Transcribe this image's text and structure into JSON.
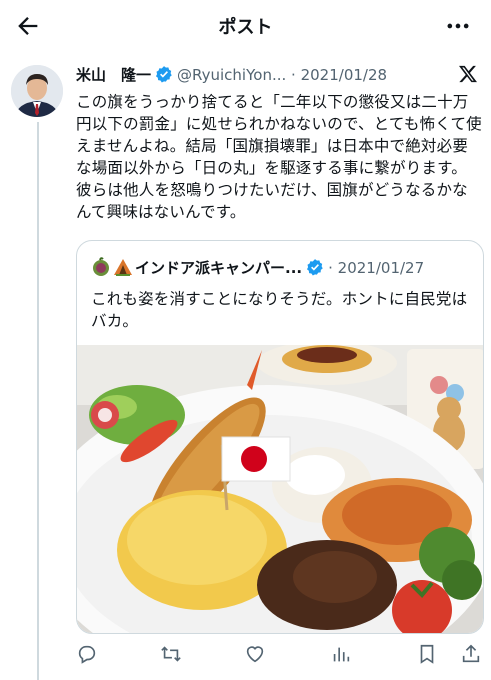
{
  "topbar": {
    "title": "ポスト",
    "back_icon": "arrow-left-icon",
    "more_icon": "more-horizontal-icon"
  },
  "post": {
    "name": "米山　隆一",
    "handle": "@RyuichiYon...",
    "separator": "·",
    "date": "2021/01/28",
    "text": "この旗をうっかり捨てると「二年以下の懲役又は二十万円以下の罰金」に処せられかねないので、とても怖くて使えませんよね。結局「国旗損壊罪」は日本中で絶対必要な場面以外から「日の丸」を駆逐する事に繋がります。彼らは他人を怒鳴りつけたいだけ、国旗がどうなるかなんて興味はないんです。"
  },
  "quote": {
    "name": "インドア派キャンパー...",
    "separator": "·",
    "date": "2021/01/27",
    "text": "これも姿を消すことになりそうだ。ホントに自民党はバカ。",
    "image_alt": "kids-lunch-plate-with-japanese-flag"
  },
  "actions": [
    "reply-icon",
    "retweet-icon",
    "like-icon",
    "views-icon",
    "bookmark-icon",
    "share-icon"
  ],
  "colors": {
    "verified": "#1d9bf0",
    "secondary_text": "#536471",
    "border": "#cfd9de",
    "text": "#0f1419"
  }
}
